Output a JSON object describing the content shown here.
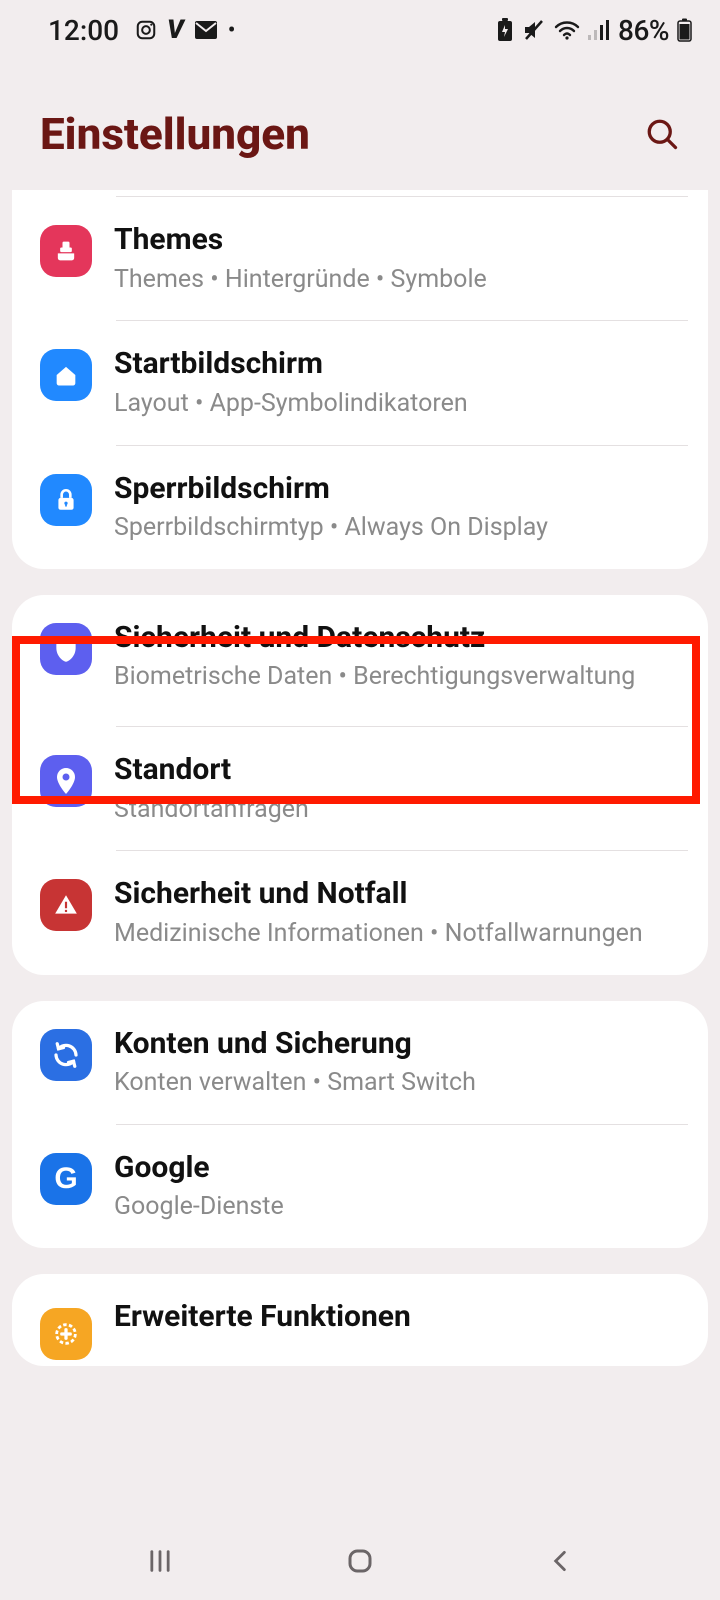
{
  "status": {
    "time": "12:00",
    "battery_pct": "86%"
  },
  "header": {
    "title": "Einstellungen"
  },
  "items": {
    "themes": {
      "title": "Themes",
      "sub": "Themes  •  Hintergründe  •  Symbole"
    },
    "home": {
      "title": "Startbildschirm",
      "sub": "Layout  •  App-Symbolindikatoren"
    },
    "lock": {
      "title": "Sperrbildschirm",
      "sub": "Sperrbildschirmtyp  •  Always On Display"
    },
    "security": {
      "title": "Sicherheit und Datenschutz",
      "sub": "Biometrische Daten  •  Berechtigungsverwaltung"
    },
    "location": {
      "title": "Standort",
      "sub": "Standortanfragen"
    },
    "emergency": {
      "title": "Sicherheit und Notfall",
      "sub": "Medizinische Informationen  •  Notfallwarnungen"
    },
    "accounts": {
      "title": "Konten und Sicherung",
      "sub": "Konten verwalten  •  Smart Switch"
    },
    "google": {
      "title": "Google",
      "sub": "Google-Dienste"
    },
    "advanced": {
      "title": "Erweiterte Funktionen"
    }
  }
}
